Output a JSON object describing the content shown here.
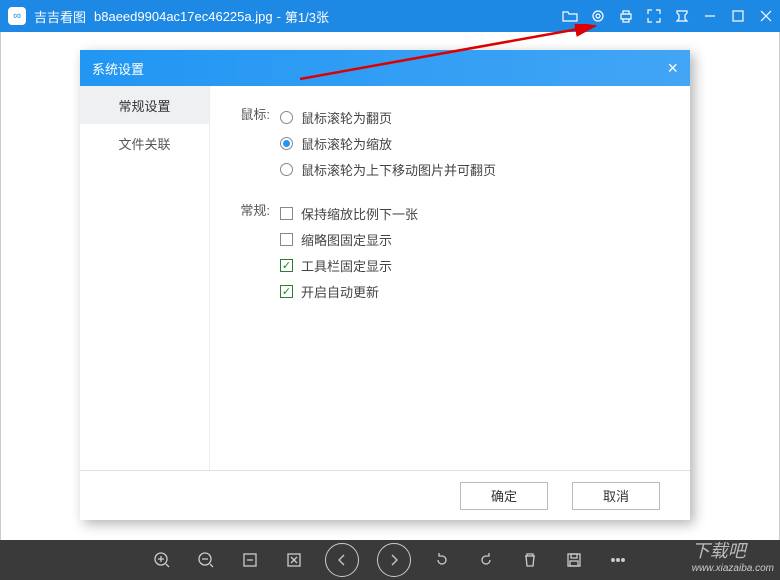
{
  "titlebar": {
    "app": "吉吉看图",
    "file": "b8aeed9904ac17ec46225a.jpg",
    "pos": "第1/3张"
  },
  "dialog": {
    "title": "系统设置",
    "tabs": [
      "常规设置",
      "文件关联"
    ],
    "mouse_label": "鼠标:",
    "mouse_opts": [
      "鼠标滚轮为翻页",
      "鼠标滚轮为缩放",
      "鼠标滚轮为上下移动图片并可翻页"
    ],
    "general_label": "常规:",
    "general_opts": [
      "保持缩放比例下一张",
      "缩略图固定显示",
      "工具栏固定显示",
      "开启自动更新"
    ],
    "ok": "确定",
    "cancel": "取消"
  },
  "watermark": {
    "main": "下载吧",
    "sub": "www.xiazaiba.com"
  }
}
